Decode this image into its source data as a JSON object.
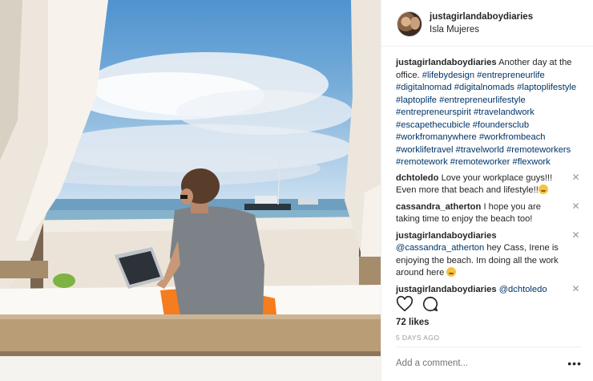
{
  "post": {
    "username": "justagirlandaboydiaries",
    "location": "Isla Mujeres"
  },
  "caption": {
    "username": "justagirlandaboydiaries",
    "text": "Another day at the office.",
    "hashtags": "#lifebydesign #entrepreneurlife #digitalnomad #digitalnomads #laptoplifestyle #laptoplife #entrepreneurlifestyle #entrepreneurspirit #travelandwork #escapethecubicle #foundersclub #workfromanywhere #workfrombeach #worklifetravel #travelworld #remoteworkers #remotework #remoteworker #flexwork"
  },
  "comments": [
    {
      "username": "dchtoledo",
      "text": "Love your workplace guys!!! Even more that beach and lifestyle!!",
      "emoji": "smile"
    },
    {
      "username": "cassandra_atherton",
      "text": "I hope you are taking time to enjoy the beach too!"
    },
    {
      "username": "justagirlandaboydiaries",
      "mention": "@cassandra_atherton",
      "text": "hey Cass, Irene is enjoying the beach. Im doing all the work around here",
      "emoji": "smile"
    },
    {
      "username": "justagirlandaboydiaries",
      "mention": "@dchtoledo",
      "text": ""
    }
  ],
  "likes": "72 likes",
  "timestamp": "5 DAYS AGO",
  "add_comment_placeholder": "Add a comment...",
  "icons": {
    "heart": "heart-icon",
    "comment": "comment-bubble-icon",
    "remove": "close-icon",
    "more": "more-options-icon"
  },
  "colors": {
    "link": "#003569",
    "text": "#262626",
    "muted": "#999999",
    "divider": "#efefef"
  }
}
